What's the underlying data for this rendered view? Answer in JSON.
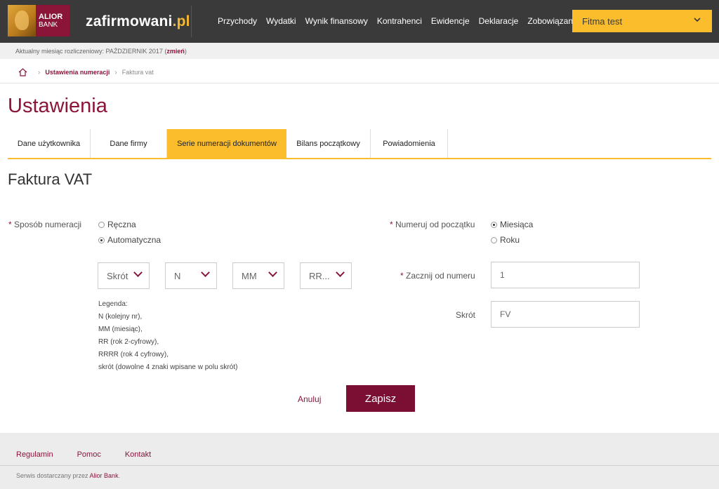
{
  "header": {
    "logo": {
      "line1": "ALIOR",
      "line2": "BANK"
    },
    "brand_main": "zafirmowani",
    "brand_tld": ".pl",
    "nav": [
      "Przychody",
      "Wydatki",
      "Wynik finansowy",
      "Kontrahenci",
      "Ewidencje",
      "Deklaracje",
      "Zobowiązania"
    ],
    "company": "Fitma test"
  },
  "month_bar": {
    "prefix": "Aktualny miesiąc rozliczeniowy: PAŹDZIERNIK 2017 (",
    "link": "zmień",
    "suffix": ")"
  },
  "breadcrumb": {
    "link": "Ustawienia numeracji",
    "current": "Faktura vat"
  },
  "page_title": "Ustawienia",
  "tabs": [
    {
      "label": "Dane użytkownika",
      "active": false
    },
    {
      "label": "Dane firmy",
      "active": false
    },
    {
      "label": "Serie numeracji dokumentów",
      "active": true
    },
    {
      "label": "Bilans początkowy",
      "active": false
    },
    {
      "label": "Powiadomienia",
      "active": false
    }
  ],
  "section_title": "Faktura VAT",
  "form": {
    "numbering_method": {
      "label": "Sposób numeracji",
      "options": [
        "Ręczna",
        "Automatyczna"
      ],
      "selected": "Automatyczna"
    },
    "reset_from": {
      "label": "Numeruj od początku",
      "options": [
        "Miesiąca",
        "Roku"
      ],
      "selected": "Miesiąca"
    },
    "pattern_selects": [
      "Skrót",
      "N",
      "MM",
      "RR..."
    ],
    "start_number": {
      "label": "Zacznij od numeru",
      "value": "1"
    },
    "abbreviation": {
      "label": "Skrót",
      "value": "FV"
    },
    "legend": [
      "Legenda:",
      "N (kolejny nr),",
      "MM (miesiąc),",
      "RR (rok 2-cyfrowy),",
      "RRRR (rok 4 cyfrowy),",
      "skrót (dowolne 4 znaki wpisane w polu skrót)"
    ],
    "cancel_label": "Anuluj",
    "save_label": "Zapisz"
  },
  "footer": {
    "links": [
      "Regulamin",
      "Pomoc",
      "Kontakt"
    ],
    "note_prefix": "Serwis dostarczany przez ",
    "note_bank": "Alior Bank",
    "note_suffix": "."
  },
  "colors": {
    "accent": "#8b1538",
    "highlight": "#fbbd2c",
    "header_bg": "#3a3a3a"
  }
}
